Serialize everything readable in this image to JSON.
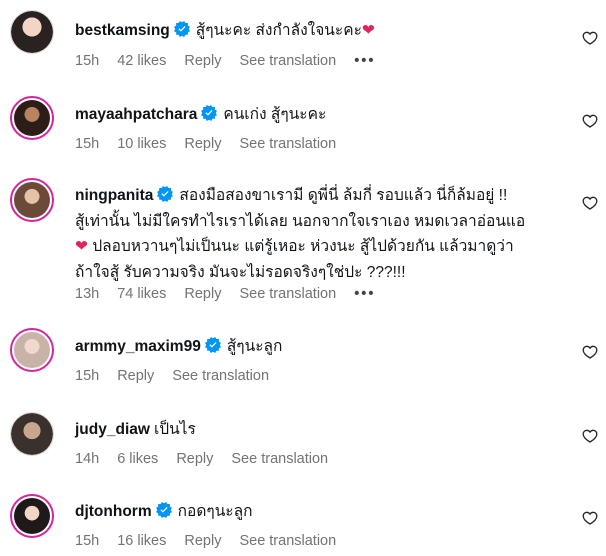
{
  "comments": [
    {
      "username": "bestkamsing",
      "verified": true,
      "text": "สู้ๆนะคะ ส่งกำลังใจนะคะ",
      "emoji": "❤",
      "time": "15h",
      "likes": "42 likes",
      "reply": "Reply",
      "see_translation": "See translation",
      "more": "•••"
    },
    {
      "username": "mayaahpatchara",
      "verified": true,
      "text": "คนเก่ง สู้ๆนะคะ",
      "time": "15h",
      "likes": "10 likes",
      "reply": "Reply",
      "see_translation": "See translation"
    },
    {
      "username": "ningpanita",
      "verified": true,
      "text_line1": "สองมือสองขาเรามี ดูพี่นี่ ล้มกี่ รอบแล้ว นี่ก็ล้มอยู่ !!",
      "text_line2": "สู้เท่านั้น ไม่มีใครทำไรเราได้เลย นอกจากใจเราเอง หมดเวลาอ่อนแอ",
      "emoji": "❤",
      "text_line3": "ปลอบหวานๆไม่เป็นนะ แต่รู้เหอะ ห่วงนะ สู้ไปด้วยกัน แล้วมาดูว่า",
      "text_line4": "ถ้าใจสู้ รับความจริง มันจะไม่รอดจริงๆใช่ปะ ???!!!",
      "time": "13h",
      "likes": "74 likes",
      "reply": "Reply",
      "see_translation": "See translation",
      "more": "•••"
    },
    {
      "username": "armmy_maxim99",
      "verified": true,
      "text": "สู้ๆนะลูก",
      "time": "15h",
      "reply": "Reply",
      "see_translation": "See translation"
    },
    {
      "username": "judy_diaw",
      "verified": false,
      "text": "เป็นไร",
      "time": "14h",
      "likes": "6 likes",
      "reply": "Reply",
      "see_translation": "See translation"
    },
    {
      "username": "djtonhorm",
      "verified": true,
      "text": "กอดๆนะลูก",
      "time": "15h",
      "likes": "16 likes",
      "reply": "Reply",
      "see_translation": "See translation"
    }
  ],
  "icons": {
    "verified": "verified-badge-icon",
    "like": "heart-outline-icon",
    "more": "more-options-icon"
  },
  "colors": {
    "verified_blue": "#0095f6",
    "meta_gray": "#737373",
    "story_ring": "#d6249f",
    "heart_red": "#e0245e"
  }
}
